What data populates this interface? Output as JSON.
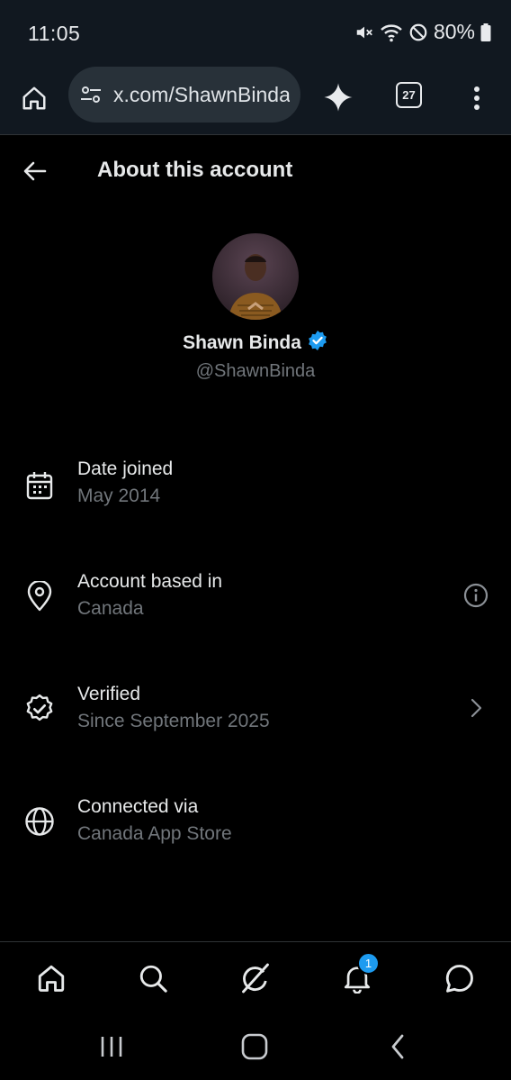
{
  "status_bar": {
    "time": "11:05",
    "battery": "80%"
  },
  "browser": {
    "url": "x.com/ShawnBinda/about",
    "tab_count": "27"
  },
  "header": {
    "title": "About this account"
  },
  "profile": {
    "name": "Shawn Binda",
    "handle": "@ShawnBinda"
  },
  "rows": [
    {
      "label": "Date joined",
      "value": "May 2014",
      "icon": "calendar-icon"
    },
    {
      "label": "Account based in",
      "value": "Canada",
      "icon": "location-pin-icon",
      "trailing": "info-icon"
    },
    {
      "label": "Verified",
      "value": "Since September 2025",
      "icon": "verified-badge-icon",
      "trailing": "chevron-right-icon"
    },
    {
      "label": "Connected via",
      "value": "Canada App Store",
      "icon": "globe-icon"
    }
  ],
  "bottom_nav": {
    "items": [
      "home-icon",
      "search-icon",
      "grok-icon",
      "notifications-icon",
      "messages-icon"
    ],
    "notification_badge": "1"
  },
  "colors": {
    "background": "#000000",
    "accent": "#1d9bf0",
    "muted_text": "#71767b",
    "browser_chrome": "#111820"
  }
}
